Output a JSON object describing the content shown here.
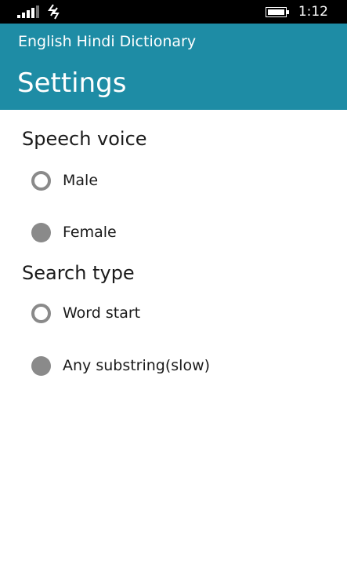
{
  "status_bar": {
    "time": "1:12",
    "icons": [
      "signal-strength-icon",
      "data-connection-icon",
      "battery-icon"
    ]
  },
  "header": {
    "app_title": "English Hindi Dictionary",
    "page_title": "Settings",
    "background_color": "#1e8ca5"
  },
  "speech_voice": {
    "heading": "Speech voice",
    "options": [
      {
        "label": "Male",
        "selected": false
      },
      {
        "label": "Female",
        "selected": true
      }
    ]
  },
  "search_type": {
    "heading": "Search type",
    "options": [
      {
        "label": "Word start",
        "selected": false
      },
      {
        "label": "Any substring(slow)",
        "selected": true
      }
    ]
  }
}
